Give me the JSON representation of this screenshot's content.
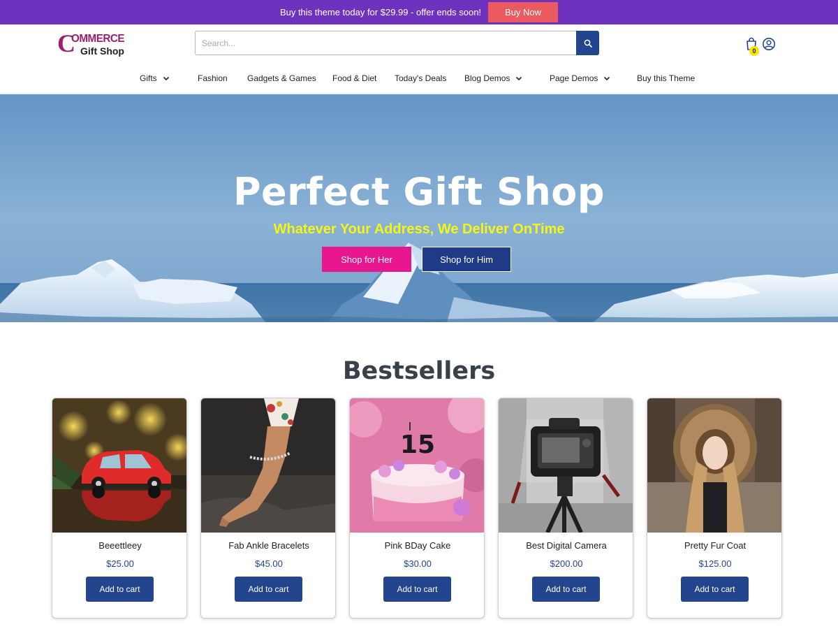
{
  "promo": {
    "text": "Buy this theme today for $29.99 - offer ends soon!",
    "button_label": "Buy Now"
  },
  "header": {
    "logo_top": "OMMERCE",
    "logo_mark": "C",
    "logo_bottom": "Gift Shop",
    "search_placeholder": "Search...",
    "cart_count": "0"
  },
  "nav": {
    "items": [
      {
        "label": "Gifts",
        "has_dropdown": true
      },
      {
        "label": "Fashion",
        "has_dropdown": false
      },
      {
        "label": "Gadgets & Games",
        "has_dropdown": false
      },
      {
        "label": "Food & Diet",
        "has_dropdown": false
      },
      {
        "label": "Today's Deals",
        "has_dropdown": false
      },
      {
        "label": "Blog Demos",
        "has_dropdown": true
      },
      {
        "label": "Page Demos",
        "has_dropdown": true
      },
      {
        "label": "Buy this Theme",
        "has_dropdown": false
      }
    ]
  },
  "hero": {
    "title": "Perfect Gift Shop",
    "subtitle": "Whatever Your Address, We Deliver OnTime",
    "btn_her": "Shop for Her",
    "btn_him": "Shop for Him"
  },
  "bestsellers": {
    "title": "Bestsellers",
    "products": [
      {
        "name": "Beeettleey",
        "price": "$25.00",
        "button": "Add to cart"
      },
      {
        "name": "Fab Ankle Bracelets",
        "price": "$45.00",
        "button": "Add to cart"
      },
      {
        "name": "Pink BDay Cake",
        "price": "$30.00",
        "button": "Add to cart"
      },
      {
        "name": "Best Digital Camera",
        "price": "$200.00",
        "button": "Add to cart"
      },
      {
        "name": "Pretty Fur Coat",
        "price": "$125.00",
        "button": "Add to cart"
      }
    ]
  },
  "colors": {
    "promo_bg": "#6f32bf",
    "buy_now": "#ea5a5e",
    "primary": "#23458d",
    "shop_her": "#e8178f",
    "hero_subtitle": "#f5f516",
    "logo": "#9b1f6d",
    "cart_badge": "#ffe600"
  },
  "icons": {
    "search": "search-icon",
    "cart": "shopping-bag-icon",
    "account": "user-circle-icon",
    "dropdown": "chevron-down-icon"
  }
}
